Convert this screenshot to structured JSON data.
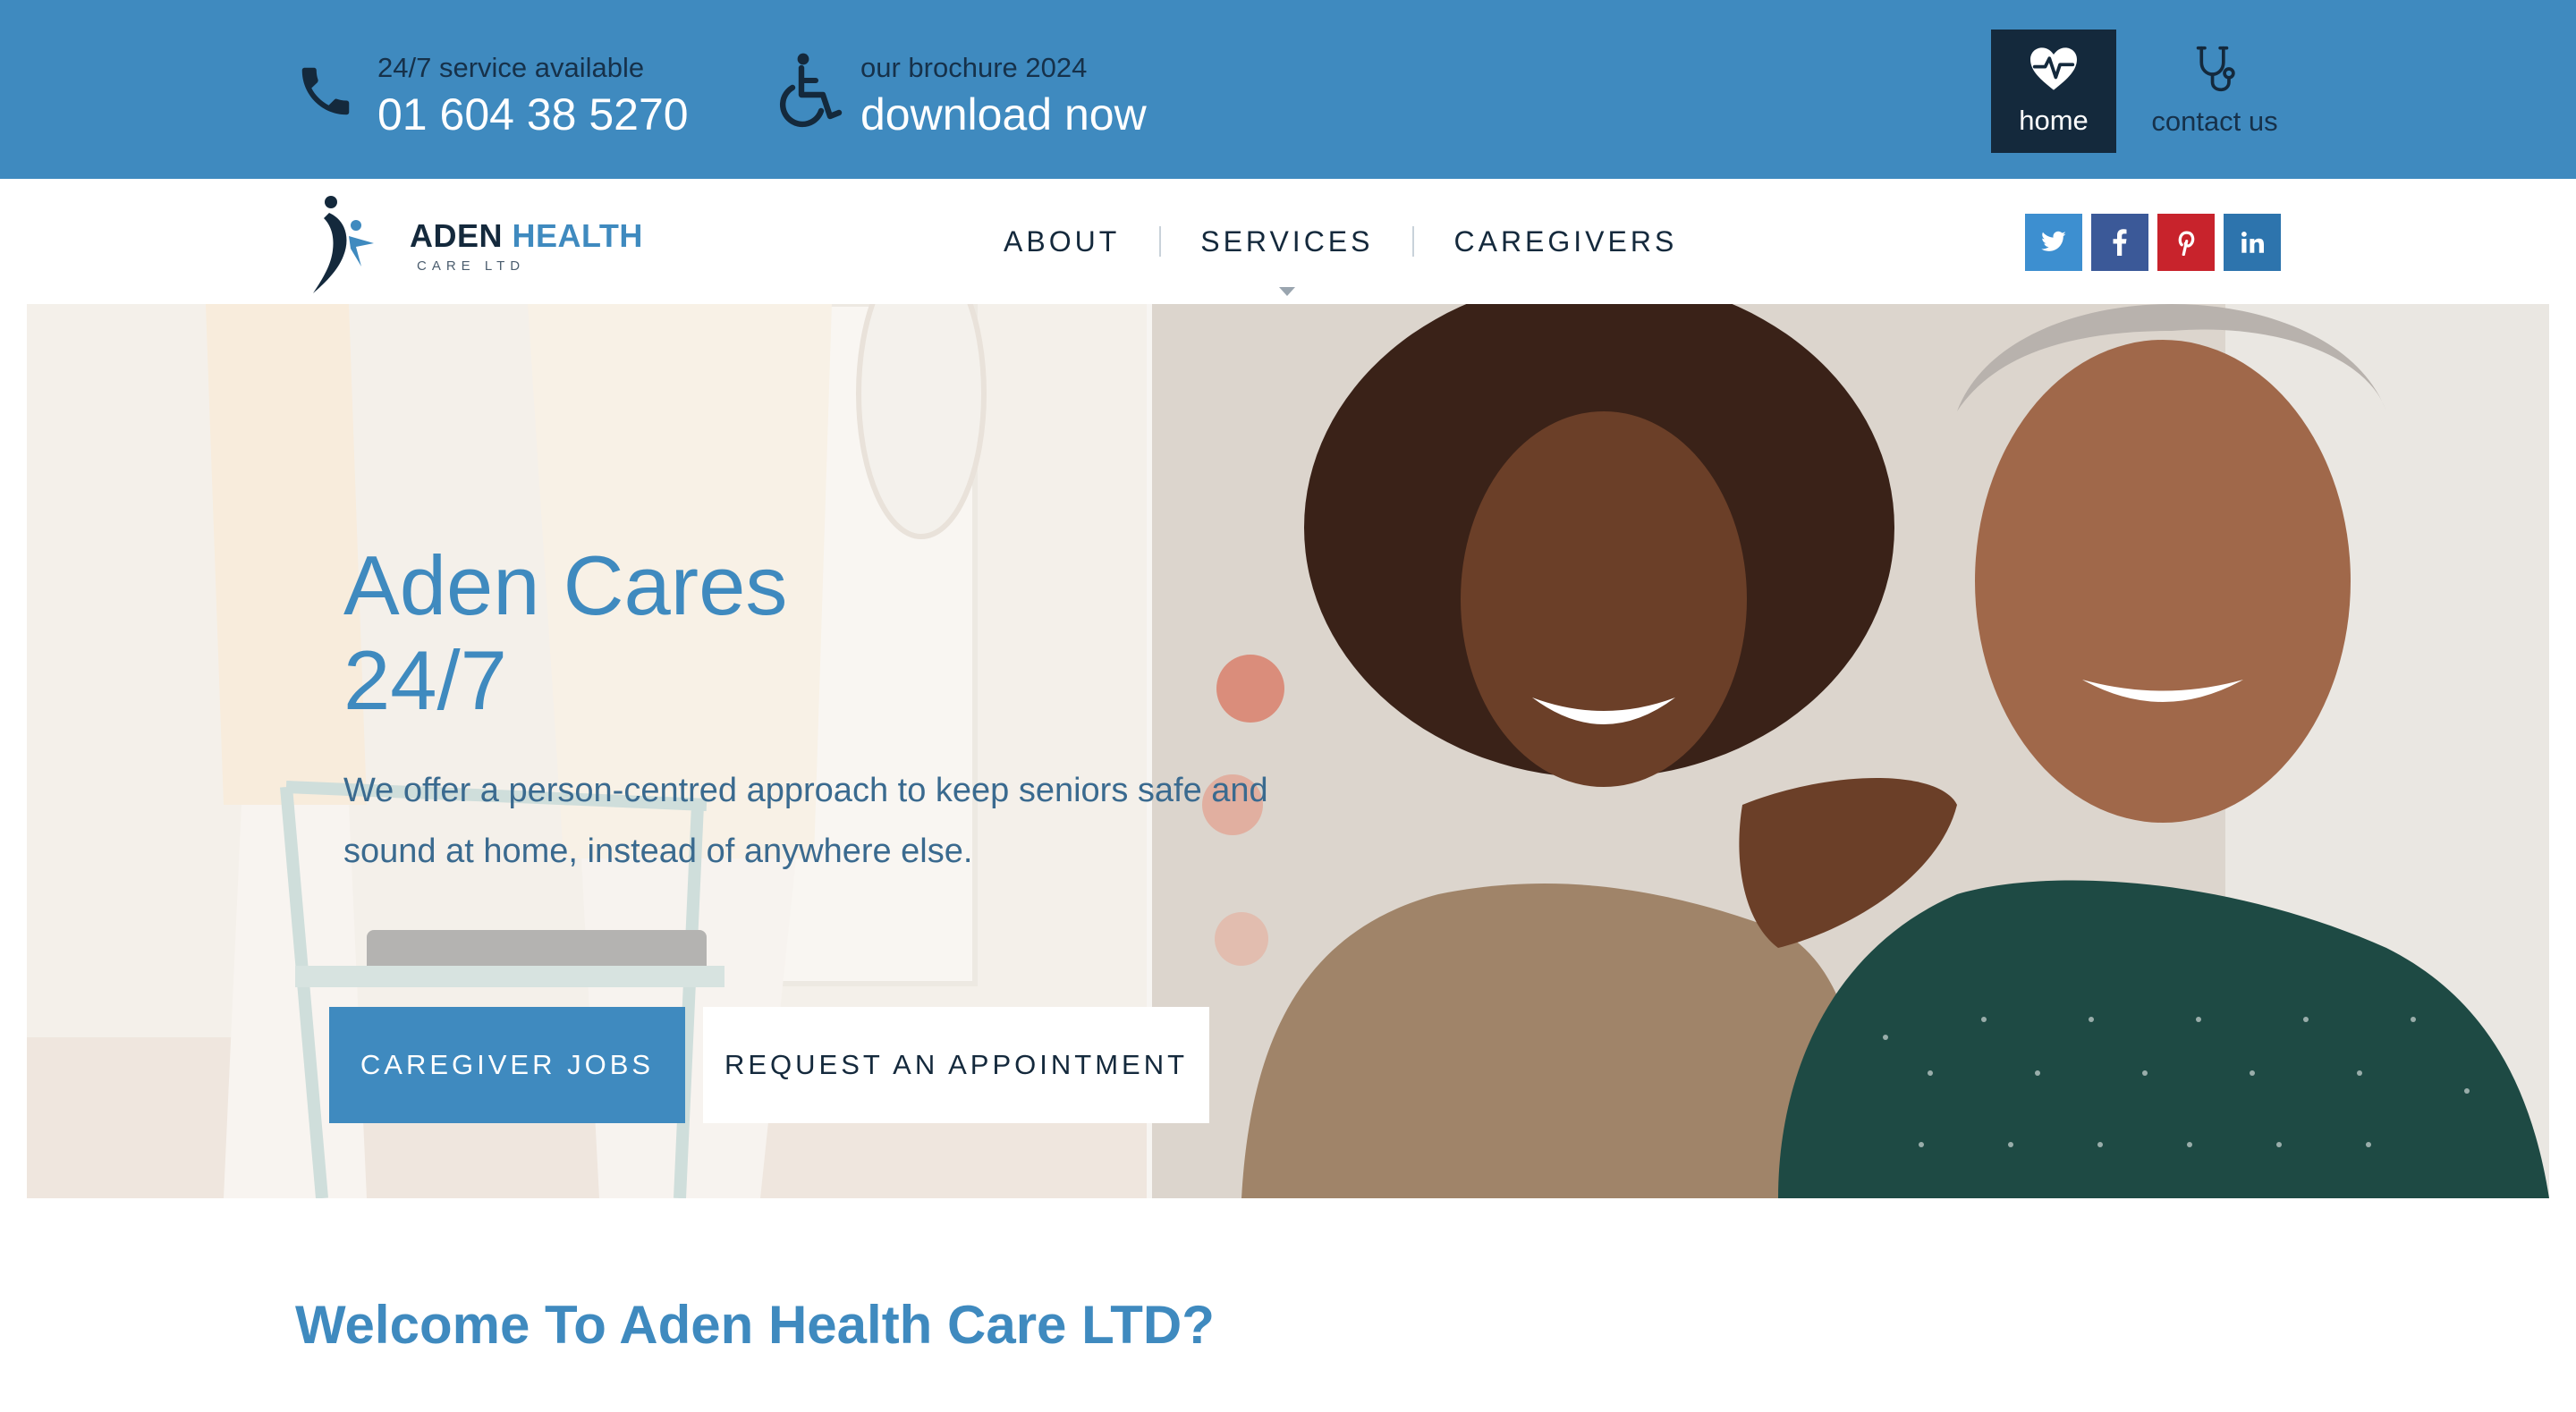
{
  "topbar": {
    "phone": {
      "caption": "24/7 service available",
      "number": "01 604 38 5270",
      "icon": "phone-icon"
    },
    "brochure": {
      "caption": "our brochure 2024",
      "action": "download now",
      "icon": "wheelchair-icon"
    },
    "nav": [
      {
        "label": "home",
        "icon": "heart-pulse-icon",
        "active": true
      },
      {
        "label": "contact us",
        "icon": "stethoscope-icon",
        "active": false
      }
    ]
  },
  "brand": {
    "name_dark": "ADEN",
    "name_blue": "HEALTH",
    "tagline": "CARE LTD"
  },
  "menu": [
    {
      "label": "ABOUT"
    },
    {
      "label": "SERVICES",
      "has_dropdown": true
    },
    {
      "label": "CAREGIVERS"
    }
  ],
  "social": [
    {
      "name": "twitter",
      "glyph": "t",
      "color": "#3d8fd0"
    },
    {
      "name": "facebook",
      "glyph": "f",
      "color": "#3b5998"
    },
    {
      "name": "pinterest",
      "glyph": "p",
      "color": "#c8232c"
    },
    {
      "name": "linkedin",
      "glyph": "in",
      "color": "#2d74ad"
    }
  ],
  "hero": {
    "title_line1": "Aden Cares",
    "title_line2": "24/7",
    "subtitle": "We offer a person-centred approach to keep seniors safe and sound at home, instead of anywhere else.",
    "primary_button": "CAREGIVER JOBS",
    "secondary_button": "REQUEST AN APPOINTMENT"
  },
  "welcome_heading": "Welcome To Aden Health Care LTD?",
  "colors": {
    "primary": "#3f8abf",
    "dark": "#14293c",
    "white": "#ffffff"
  }
}
